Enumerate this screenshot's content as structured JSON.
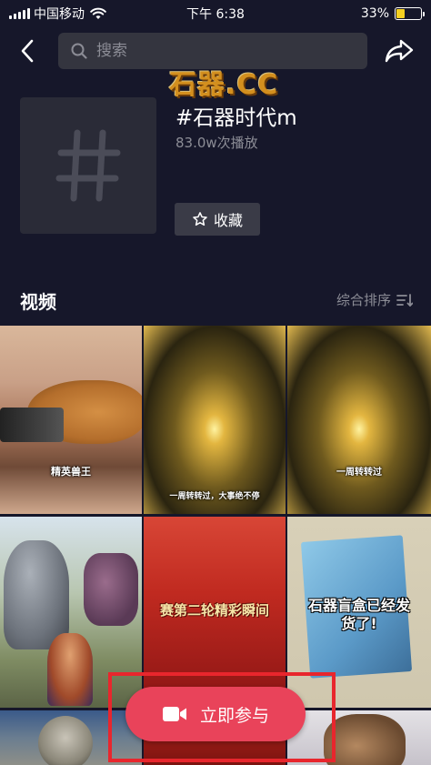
{
  "status_bar": {
    "carrier": "中国移动",
    "time": "下午 6:38",
    "battery_percent": "33%",
    "battery_level": 0.33
  },
  "nav": {
    "search_placeholder": "搜索",
    "back_icon": "chevron-left-icon",
    "share_icon": "share-arrow-icon"
  },
  "watermark": "石器.CC",
  "topic": {
    "title": "#石器时代m",
    "play_count": "83.0w次播放",
    "favorite_label": "收藏"
  },
  "section": {
    "title": "视频",
    "sort_label": "综合排序"
  },
  "videos": [
    {
      "caption": "精英兽王"
    },
    {
      "caption": "一周转转过，大事绝不停"
    },
    {
      "caption": "一周转转过"
    },
    {
      "caption": ""
    },
    {
      "caption": "赛第二轮精彩瞬间"
    },
    {
      "caption": "石器盲盒已经发货了!"
    },
    {
      "caption": ""
    },
    {
      "caption": ""
    },
    {
      "caption": ""
    }
  ],
  "join_button": {
    "label": "立即参与"
  },
  "colors": {
    "background": "#16172a",
    "accent": "#e9435a",
    "highlight": "#e8262d"
  }
}
